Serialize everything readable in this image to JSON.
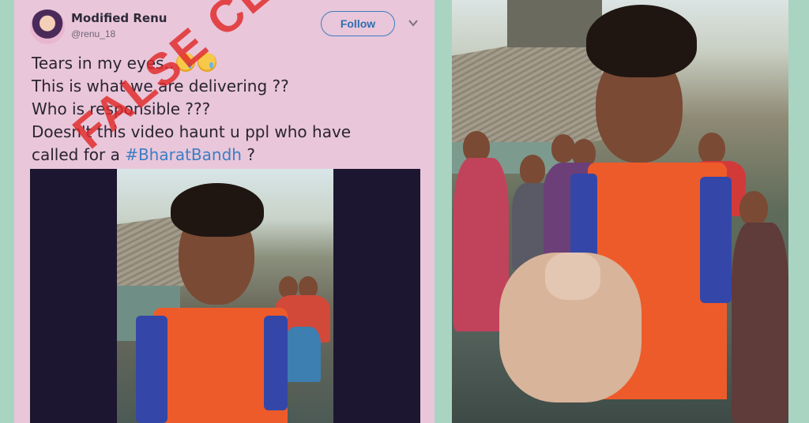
{
  "tweet": {
    "author_name": "Modified Renu",
    "author_handle": "@renu_18",
    "follow_label": "Follow",
    "text_line1": "Tears in my eyes..",
    "text_line2": "This is what we are delivering ??",
    "text_line3": "Who is responsible ???",
    "text_line4": "Doesn't this video haunt u ppl who have",
    "text_line5_prefix": "called for a ",
    "hashtag": "#BharatBandh",
    "text_line5_suffix": " ?"
  },
  "stamp": {
    "label": "FALSE CLAIM",
    "color": "#e02828"
  },
  "icons": {
    "more": "chevron-down-icon",
    "emoji": "crying-face-icon"
  },
  "colors": {
    "background": "#a9d4c2",
    "card": "#e9c6d9",
    "accent": "#3b7ec4"
  }
}
